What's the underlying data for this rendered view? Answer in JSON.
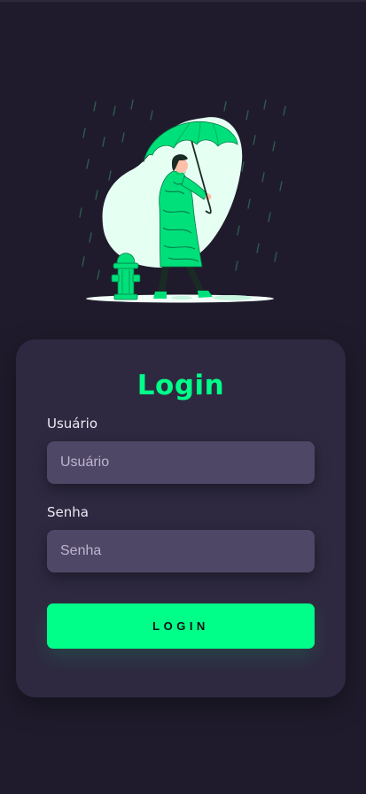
{
  "colors": {
    "background": "#1f1b2c",
    "card": "#2e2940",
    "input_bg": "#4f4766",
    "accent": "#00ff88",
    "text": "#ece9f5"
  },
  "illustration": {
    "icon": "person-with-umbrella-in-rain-illustration"
  },
  "login": {
    "title": "Login",
    "username": {
      "label": "Usuário",
      "placeholder": "Usuário",
      "value": ""
    },
    "password": {
      "label": "Senha",
      "placeholder": "Senha",
      "value": ""
    },
    "button_label": "LOGIN"
  }
}
